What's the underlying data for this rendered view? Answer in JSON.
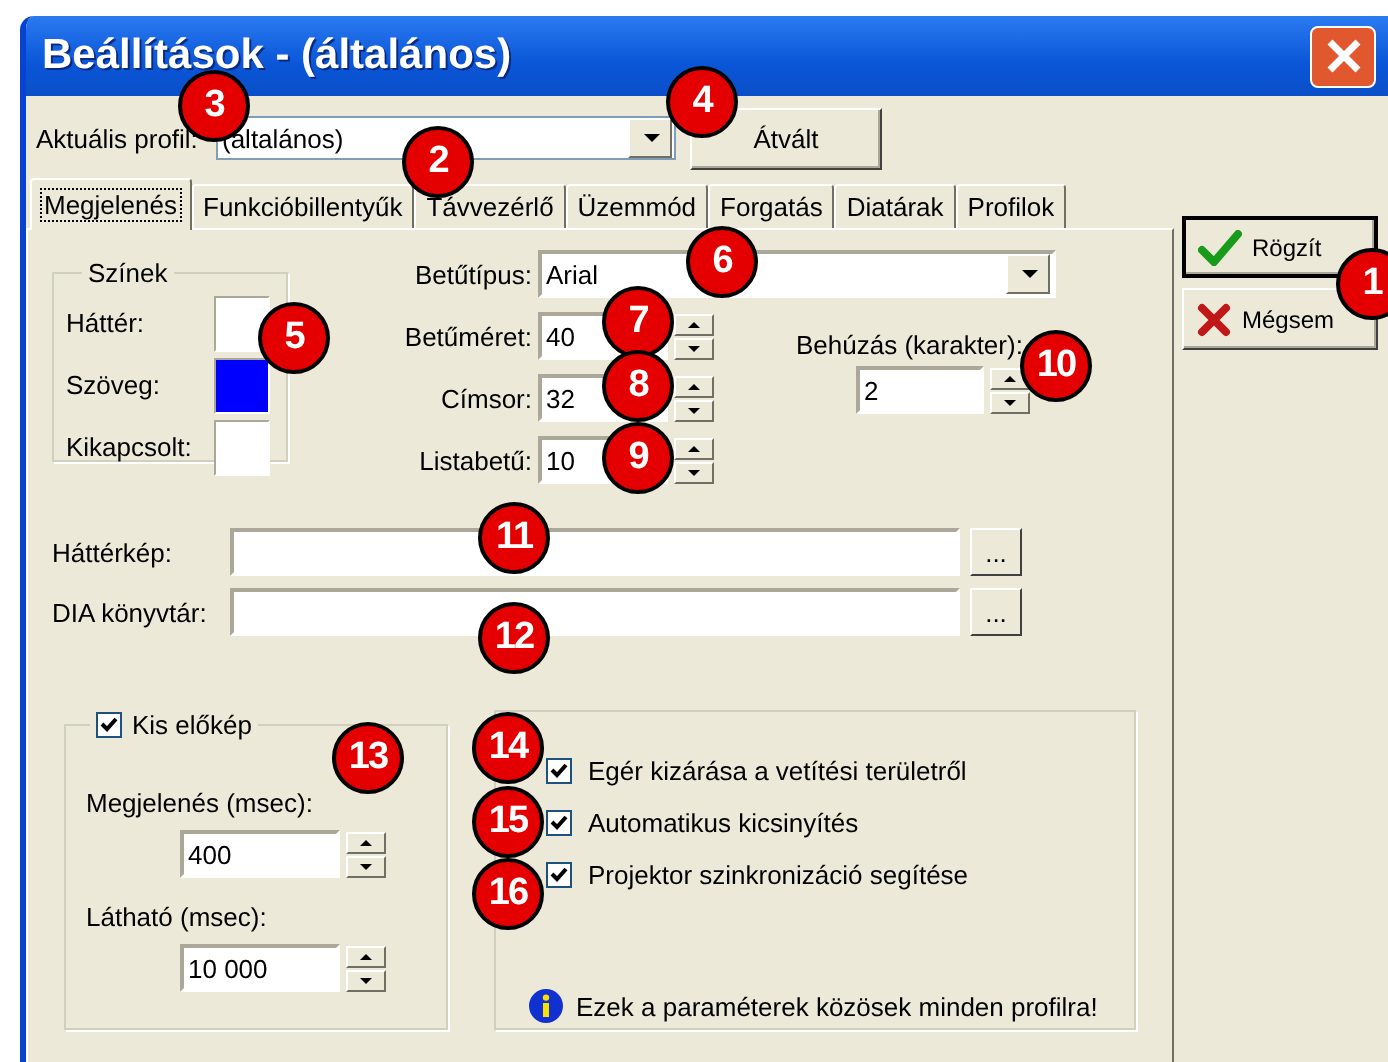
{
  "window": {
    "title": "Beállítások - (általános)"
  },
  "profile": {
    "label": "Aktuális profil:",
    "value": "(általános)",
    "button": "Átvált"
  },
  "tabs": [
    {
      "label": "Megjelenés",
      "selected": true
    },
    {
      "label": "Funkcióbillentyűk",
      "selected": false
    },
    {
      "label": "Távvezérlő",
      "selected": false
    },
    {
      "label": "Üzemmód",
      "selected": false
    },
    {
      "label": "Forgatás",
      "selected": false
    },
    {
      "label": "Diatárak",
      "selected": false
    },
    {
      "label": "Profilok",
      "selected": false
    }
  ],
  "actions": [
    {
      "label": "Rögzít",
      "kind": "ok"
    },
    {
      "label": "Mégsem",
      "kind": "cancel"
    }
  ],
  "colors": {
    "title": "Színek",
    "items": [
      {
        "label": "Háttér:",
        "color": "#ffffff"
      },
      {
        "label": "Szöveg:",
        "color": "#0000ff"
      },
      {
        "label": "Kikapcsolt:",
        "color": "#ffffff"
      }
    ]
  },
  "font": {
    "label": "Betűtípus:",
    "value": "Arial"
  },
  "sizes": [
    {
      "label": "Betűméret:",
      "value": "40"
    },
    {
      "label": "Címsor:",
      "value": "32"
    },
    {
      "label": "Listabetű:",
      "value": "10"
    }
  ],
  "indent": {
    "label": "Behúzás (karakter):",
    "value": "2"
  },
  "paths": [
    {
      "label": "Háttérkép:",
      "button": "..."
    },
    {
      "label": "DIA könyvtár:",
      "button": "..."
    }
  ],
  "preview": {
    "label": "Kis előkép",
    "checked": true,
    "fields": [
      {
        "label": "Megjelenés (msec):",
        "value": "400"
      },
      {
        "label": "Látható (msec):",
        "value": "10 000"
      }
    ]
  },
  "options": [
    {
      "label": "Egér kizárása a vetítési területről",
      "checked": true
    },
    {
      "label": "Automatikus kicsinyítés",
      "checked": true
    },
    {
      "label": "Projektor szinkronizáció segítése",
      "checked": true
    }
  ],
  "note": "Ezek a paraméterek közösek minden profilra!",
  "callouts": [
    "1",
    "2",
    "3",
    "4",
    "5",
    "6",
    "7",
    "8",
    "9",
    "10",
    "11",
    "12",
    "13",
    "14",
    "15",
    "16"
  ]
}
